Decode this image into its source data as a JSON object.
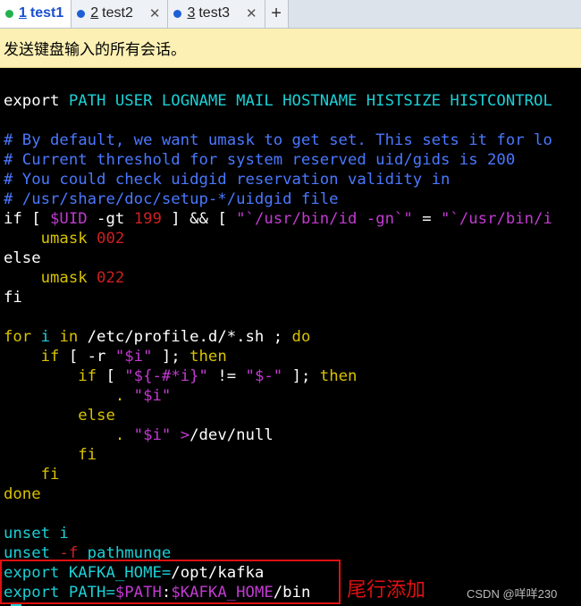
{
  "tabs": [
    {
      "num": "1",
      "label": "test1",
      "dot_color": "#22b14c",
      "active": true
    },
    {
      "num": "2",
      "label": "test2",
      "dot_color": "#1e5fd6",
      "active": false
    },
    {
      "num": "3",
      "label": "test3",
      "dot_color": "#1e5fd6",
      "active": false
    }
  ],
  "tab_close_glyph": "✕",
  "add_tab_glyph": "+",
  "notice_text": "发送键盘输入的所有会话。",
  "annotation": "尾行添加",
  "watermark": "CSDN @咩咩230",
  "code": {
    "l1": {
      "a": "export",
      "b": " PATH USER LOGNAME MAIL HOSTNAME HISTSIZE HISTCONTROL"
    },
    "l2": "# By default, we want umask to get set. This sets it for lo",
    "l3": "# Current threshold for system reserved uid/gids is 200",
    "l4": "# You could check uidgid reservation validity in",
    "l5": "# /usr/share/doc/setup-*/uidgid file",
    "l6": {
      "a": "if",
      "b": " [ ",
      "c": "$UID",
      "d": " -gt ",
      "e": "199",
      "f": " ] && [ ",
      "g": "\"`/usr/bin/id -gn`\"",
      "h": " = ",
      "i": "\"`/usr/bin/i"
    },
    "l7": {
      "a": "    umask ",
      "b": "002"
    },
    "l8": "else",
    "l9": {
      "a": "    umask ",
      "b": "022"
    },
    "l10": "fi",
    "l11": {
      "a": "for",
      "b": " i ",
      "c": "in",
      "d": " /etc/profile.d/*.sh ; ",
      "e": "do"
    },
    "l12": {
      "a": "    if",
      "b": " [ -r ",
      "c": "\"",
      "d": "$i",
      "e": "\"",
      "f": " ]; ",
      "g": "then"
    },
    "l13": {
      "a": "        if",
      "b": " [ ",
      "c": "\"",
      "d": "${-#*i}",
      "e": "\"",
      "f": " != ",
      "g": "\"",
      "h": "$-",
      "i": "\"",
      "j": " ]; ",
      "k": "then"
    },
    "l14": {
      "a": "            . ",
      "b": "\"",
      "c": "$i",
      "d": "\""
    },
    "l15": "        else",
    "l16": {
      "a": "            . ",
      "b": "\"",
      "c": "$i",
      "d": "\"",
      "e": " >",
      "f": "/dev/null"
    },
    "l17": "        fi",
    "l18": "    fi",
    "l19": "done",
    "l20": {
      "a": "unset",
      "b": " i"
    },
    "l21": {
      "a": "unset",
      "b": " -f",
      "c": " pathmunge"
    },
    "l22": {
      "a": "export",
      "b": " KAFKA_HOME=",
      "c": "/opt/kafka"
    },
    "l23": {
      "a": "export",
      "b": " PATH=",
      "c": "$PATH",
      "d": ":",
      "e": "$KAFKA_HOME",
      "f": "/bin"
    }
  }
}
